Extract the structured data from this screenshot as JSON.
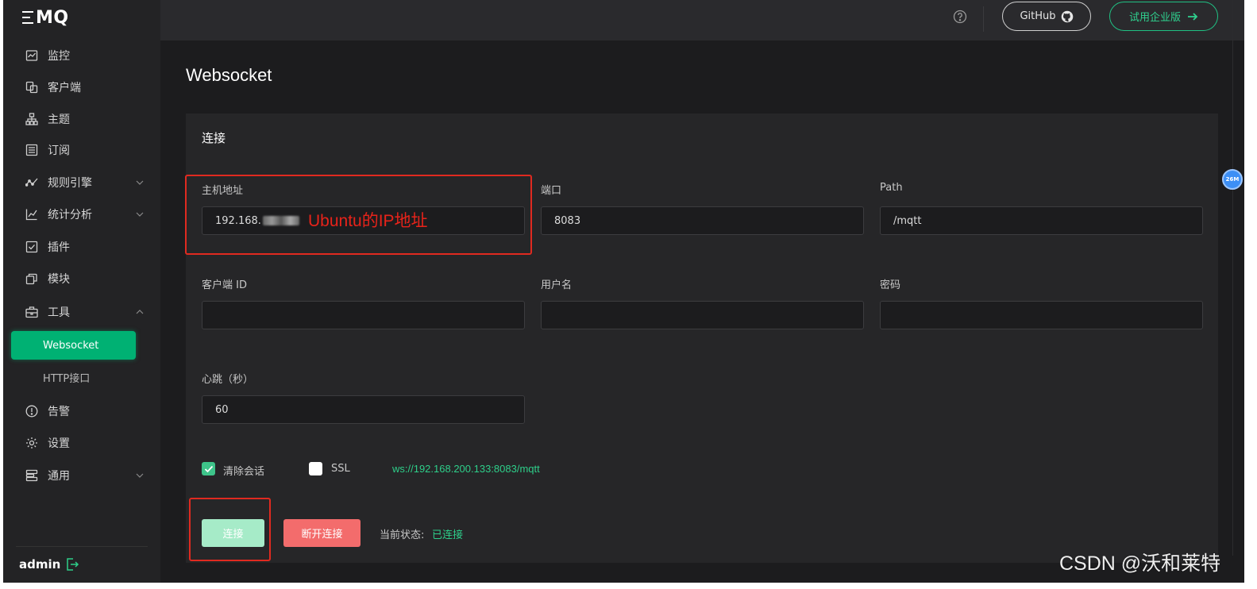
{
  "logo": {
    "text": "MQ"
  },
  "sidebar": {
    "items": [
      {
        "label": "监控",
        "icon": "monitor-chart-icon"
      },
      {
        "label": "客户端",
        "icon": "clients-icon"
      },
      {
        "label": "主题",
        "icon": "topic-tree-icon"
      },
      {
        "label": "订阅",
        "icon": "subscription-list-icon"
      },
      {
        "label": "规则引擎",
        "icon": "rule-engine-icon",
        "expandable": true
      },
      {
        "label": "统计分析",
        "icon": "analytics-icon",
        "expandable": true
      },
      {
        "label": "插件",
        "icon": "plugin-check-icon"
      },
      {
        "label": "模块",
        "icon": "module-icon"
      },
      {
        "label": "工具",
        "icon": "toolbox-icon",
        "expanded": true
      }
    ],
    "tools_submenu": [
      {
        "label": "Websocket",
        "active": true
      },
      {
        "label": "HTTP接口"
      }
    ],
    "bottom_items": [
      {
        "label": "告警",
        "icon": "alert-icon"
      },
      {
        "label": "设置",
        "icon": "settings-gear-icon"
      },
      {
        "label": "通用",
        "icon": "general-icon",
        "expandable": true
      }
    ],
    "user": "admin"
  },
  "header": {
    "github_label": "GitHub",
    "trial_label": "试用企业版"
  },
  "page": {
    "title": "Websocket"
  },
  "connection": {
    "section_title": "连接",
    "host_label": "主机地址",
    "host_value": "192.168.",
    "port_label": "端口",
    "port_value": "8083",
    "path_label": "Path",
    "path_value": "/mqtt",
    "client_id_label": "客户端 ID",
    "client_id_value": "",
    "username_label": "用户名",
    "username_value": "",
    "password_label": "密码",
    "password_value": "",
    "keepalive_label": "心跳（秒）",
    "keepalive_value": "60",
    "clean_session_label": "清除会话",
    "clean_session_checked": true,
    "ssl_label": "SSL",
    "ssl_checked": false,
    "ws_url": "ws://192.168.200.133:8083/mqtt",
    "connect_label": "连接",
    "disconnect_label": "断开连接",
    "status_label": "当前状态:",
    "status_value": "已连接"
  },
  "annotation": {
    "host_note": "Ubuntu的IP地址"
  },
  "floating_badge": "26M",
  "watermark": "CSDN @沃和莱特",
  "colors": {
    "accent": "#00b173",
    "danger": "#f36c6c",
    "annotation_red": "#e02a20",
    "success_text": "#2ecf8a"
  }
}
